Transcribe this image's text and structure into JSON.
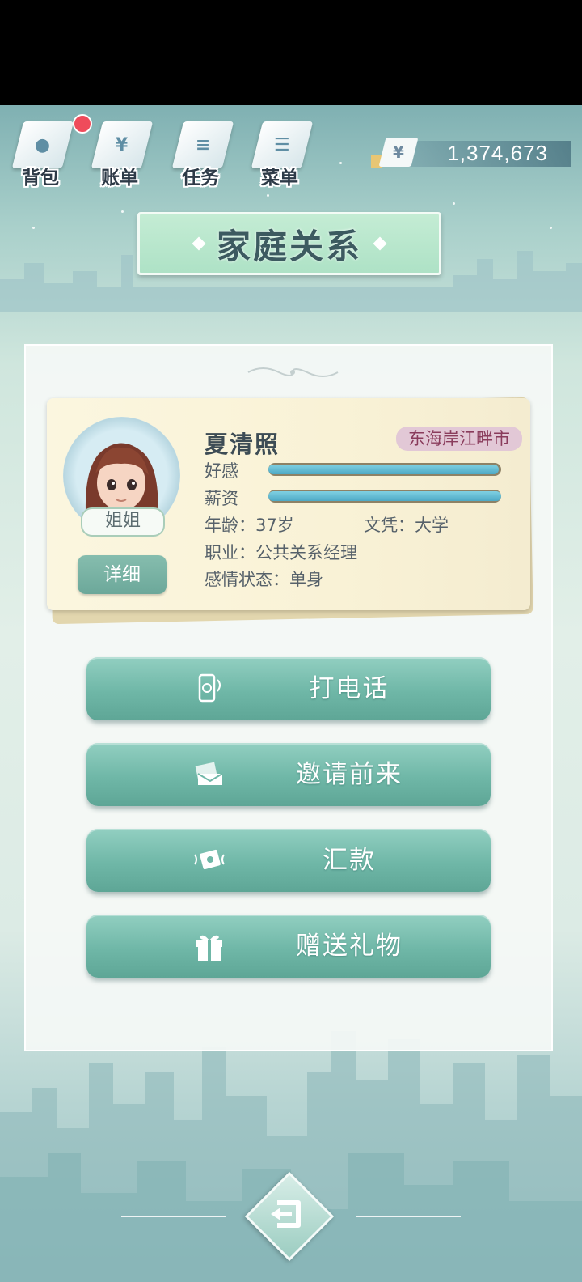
{
  "toolbar": {
    "items": [
      {
        "label": "背包",
        "icon": "backpack-icon",
        "has_notification": true
      },
      {
        "label": "账单",
        "icon": "bill-icon",
        "glyph": "¥"
      },
      {
        "label": "任务",
        "icon": "task-list-icon"
      },
      {
        "label": "菜单",
        "icon": "menu-icon"
      }
    ],
    "money": {
      "currency_symbol": "¥",
      "amount": "1,374,673"
    }
  },
  "title": "家庭关系",
  "profile": {
    "name": "夏清照",
    "relation": "姐姐",
    "location": "东海岸江畔市",
    "favor_label": "好感",
    "favor_level": 0.99,
    "salary_label": "薪资",
    "salary_level": 1.0,
    "age_text": "年龄：37岁",
    "education_text": "文凭：大学",
    "job_text": "职业：公共关系经理",
    "relationship_text": "感情状态：单身",
    "detail_button": "详细"
  },
  "actions": [
    {
      "label": "打电话",
      "icon": "phone-icon"
    },
    {
      "label": "邀请前来",
      "icon": "invitation-icon"
    },
    {
      "label": "汇款",
      "icon": "money-transfer-icon"
    },
    {
      "label": "赠送礼物",
      "icon": "gift-icon"
    }
  ],
  "back_button": {
    "icon": "back-arrow-icon"
  },
  "colors": {
    "accent": "#6fb7a7",
    "bar_fill": "#4ea9c5",
    "location_text": "#8a3c5c"
  }
}
